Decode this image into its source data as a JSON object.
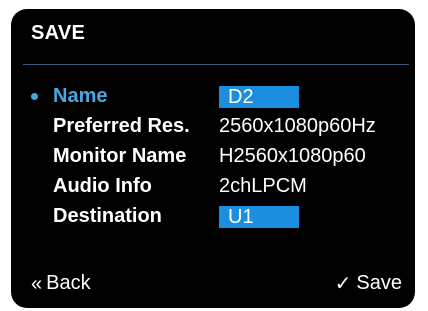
{
  "title": "SAVE",
  "rows": [
    {
      "label": "Name",
      "value": "D2",
      "kind": "field",
      "selected": true
    },
    {
      "label": "Preferred Res.",
      "value": "2560x1080p60Hz",
      "kind": "text"
    },
    {
      "label": "Monitor Name",
      "value": "H2560x1080p60",
      "kind": "text"
    },
    {
      "label": "Audio Info",
      "value": "2chLPCM",
      "kind": "text"
    },
    {
      "label": "Destination",
      "value": "U1",
      "kind": "field"
    }
  ],
  "footer": {
    "back_label": "Back",
    "back_icon": "double-chevron-left-icon",
    "save_label": "Save",
    "save_icon": "check-icon"
  },
  "colors": {
    "background": "#000000",
    "accent": "#4aa6e0",
    "field": "#1c8ee0",
    "text": "#ffffff"
  }
}
